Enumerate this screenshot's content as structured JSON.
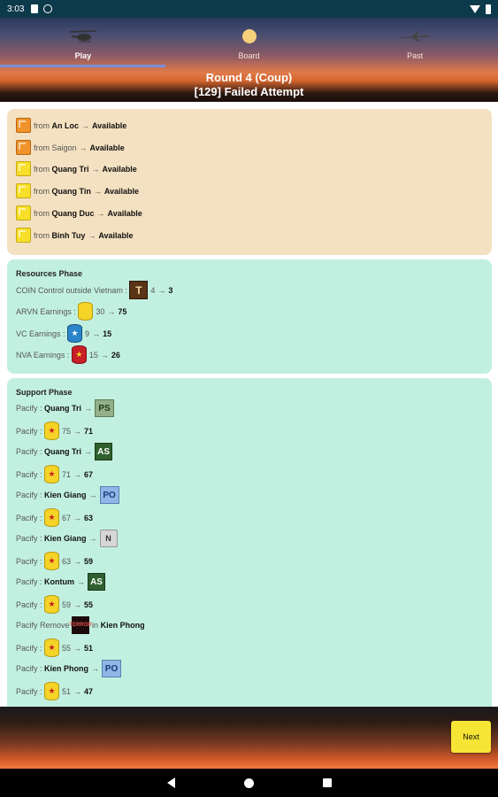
{
  "status": {
    "time": "3:03"
  },
  "tabs": [
    {
      "label": "Play",
      "icon": "helicopter-icon"
    },
    {
      "label": "Board",
      "icon": "sun-icon"
    },
    {
      "label": "Past",
      "icon": "plane-icon"
    }
  ],
  "title": {
    "line1": "Round 4 (Coup)",
    "line2": "[129] Failed Attempt"
  },
  "units": [
    {
      "piece": "orange-cube",
      "from": "from",
      "place": "An Loc",
      "arrow": "→",
      "result": "Available"
    },
    {
      "piece": "orange-cube",
      "from": "from",
      "place": "Saigon",
      "arrow": "→",
      "result": "Available"
    },
    {
      "piece": "yellow-cube",
      "from": "from",
      "place": "Quang Tri",
      "arrow": "→",
      "result": "Available"
    },
    {
      "piece": "yellow-cube",
      "from": "from",
      "place": "Quang Tin",
      "arrow": "→",
      "result": "Available"
    },
    {
      "piece": "yellow-cube",
      "from": "from",
      "place": "Quang Duc",
      "arrow": "→",
      "result": "Available"
    },
    {
      "piece": "yellow-cube",
      "from": "from",
      "place": "Binh Tuy",
      "arrow": "→",
      "result": "Available"
    }
  ],
  "resources": {
    "heading": "Resources Phase",
    "rows": [
      {
        "label": "COIN Control outside Vietnam :",
        "marker": "T",
        "from": "4",
        "arrow": "→",
        "to": "3"
      },
      {
        "label": "ARVN Earnings :",
        "from": "30",
        "arrow": "→",
        "to": "75"
      },
      {
        "label": "VC Earnings :",
        "from": "9",
        "arrow": "→",
        "to": "15"
      },
      {
        "label": "NVA Earnings :",
        "from": "15",
        "arrow": "→",
        "to": "26"
      }
    ]
  },
  "support": {
    "heading": "Support Phase",
    "rows": [
      {
        "label": "Pacify :",
        "place": "Quang Tri",
        "arrow": "→",
        "marker": "PS"
      },
      {
        "label": "Pacify :",
        "from": "75",
        "arrow": "→",
        "to": "71"
      },
      {
        "label": "Pacify :",
        "place": "Quang Tri",
        "arrow": "→",
        "marker": "AS"
      },
      {
        "label": "Pacify :",
        "from": "71",
        "arrow": "→",
        "to": "67"
      },
      {
        "label": "Pacify :",
        "place": "Kien Giang",
        "arrow": "→",
        "marker": "PO"
      },
      {
        "label": "Pacify :",
        "from": "67",
        "arrow": "→",
        "to": "63"
      },
      {
        "label": "Pacify :",
        "place": "Kien Giang",
        "arrow": "→",
        "marker": "N"
      },
      {
        "label": "Pacify :",
        "from": "63",
        "arrow": "→",
        "to": "59"
      },
      {
        "label": "Pacify :",
        "place": "Kontum",
        "arrow": "→",
        "marker": "AS"
      },
      {
        "label": "Pacify :",
        "from": "59",
        "arrow": "→",
        "to": "55"
      },
      {
        "label": "Pacify Remove",
        "marker": "TERROR",
        "in": "in",
        "place": "Kien Phong"
      },
      {
        "label": "Pacify :",
        "from": "55",
        "arrow": "→",
        "to": "51"
      },
      {
        "label": "Pacify :",
        "place": "Kien Phong",
        "arrow": "→",
        "marker": "PO"
      },
      {
        "label": "Pacify :",
        "from": "51",
        "arrow": "→",
        "to": "47"
      }
    ]
  },
  "footer": {
    "next_label": "Next"
  },
  "colors": {
    "tan_card": "#f4e1c1",
    "mint_card": "#c2f0e0",
    "next_button": "#f7e536"
  }
}
